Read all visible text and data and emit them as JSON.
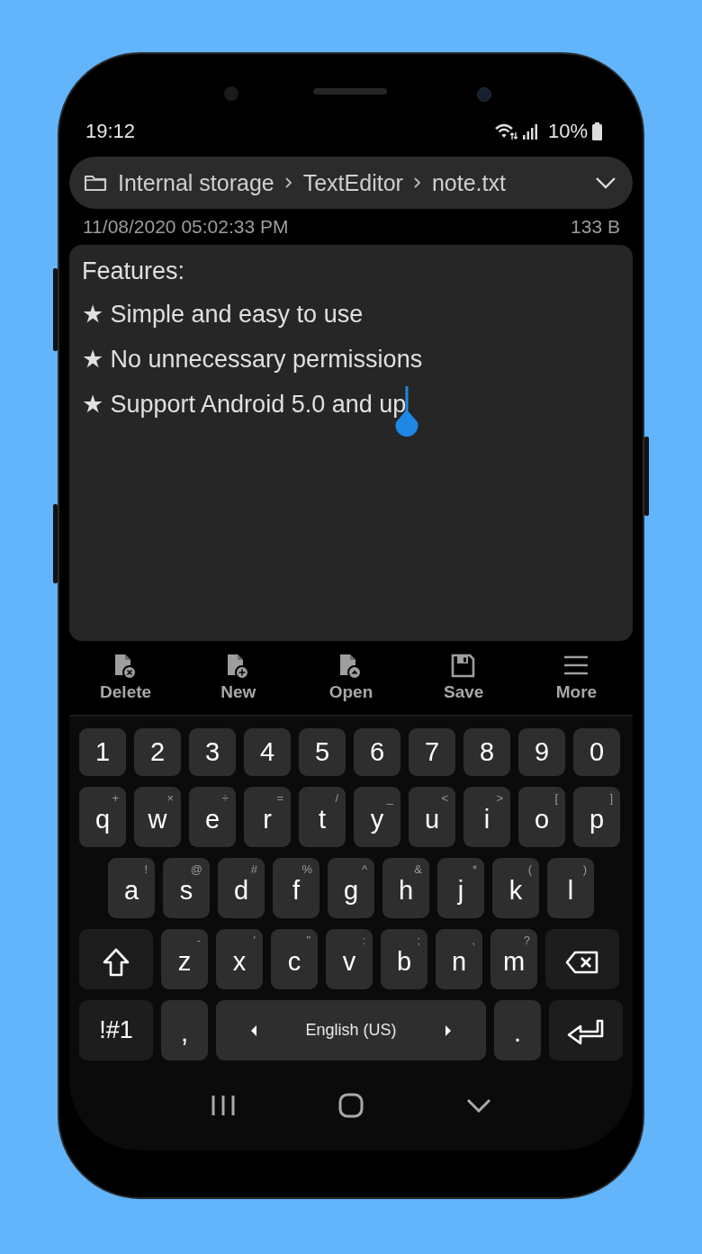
{
  "status_bar": {
    "time": "19:12",
    "battery": "10%"
  },
  "breadcrumb": {
    "parts": [
      "Internal storage",
      "TextEditor",
      "note.txt"
    ]
  },
  "file_info": {
    "modified": "11/08/2020 05:02:33 PM",
    "size": "133 B"
  },
  "editor": {
    "lines": [
      "Features:",
      "★ Simple and easy to use",
      "★ No unnecessary permissions",
      "★ Support Android 5.0 and up"
    ]
  },
  "toolbar": [
    {
      "kind": "delete",
      "label": "Delete"
    },
    {
      "kind": "new",
      "label": "New"
    },
    {
      "kind": "open",
      "label": "Open"
    },
    {
      "kind": "save",
      "label": "Save"
    },
    {
      "kind": "more",
      "label": "More"
    }
  ],
  "keyboard": {
    "rows": [
      {
        "keys": [
          {
            "kind": "char",
            "label": "1"
          },
          {
            "kind": "char",
            "label": "2"
          },
          {
            "kind": "char",
            "label": "3"
          },
          {
            "kind": "char",
            "label": "4"
          },
          {
            "kind": "char",
            "label": "5"
          },
          {
            "kind": "char",
            "label": "6"
          },
          {
            "kind": "char",
            "label": "7"
          },
          {
            "kind": "char",
            "label": "8"
          },
          {
            "kind": "char",
            "label": "9"
          },
          {
            "kind": "char",
            "label": "0"
          }
        ]
      },
      {
        "keys": [
          {
            "kind": "char",
            "label": "q",
            "hint": "+"
          },
          {
            "kind": "char",
            "label": "w",
            "hint": "×"
          },
          {
            "kind": "char",
            "label": "e",
            "hint": "÷"
          },
          {
            "kind": "char",
            "label": "r",
            "hint": "="
          },
          {
            "kind": "char",
            "label": "t",
            "hint": "/"
          },
          {
            "kind": "char",
            "label": "y",
            "hint": "_"
          },
          {
            "kind": "char",
            "label": "u",
            "hint": "<"
          },
          {
            "kind": "char",
            "label": "i",
            "hint": ">"
          },
          {
            "kind": "char",
            "label": "o",
            "hint": "["
          },
          {
            "kind": "char",
            "label": "p",
            "hint": "]"
          }
        ]
      },
      {
        "keys": [
          {
            "kind": "char",
            "label": "a",
            "hint": "!"
          },
          {
            "kind": "char",
            "label": "s",
            "hint": "@"
          },
          {
            "kind": "char",
            "label": "d",
            "hint": "#"
          },
          {
            "kind": "char",
            "label": "f",
            "hint": "%"
          },
          {
            "kind": "char",
            "label": "g",
            "hint": "^"
          },
          {
            "kind": "char",
            "label": "h",
            "hint": "&"
          },
          {
            "kind": "char",
            "label": "j",
            "hint": "*"
          },
          {
            "kind": "char",
            "label": "k",
            "hint": "("
          },
          {
            "kind": "char",
            "label": "l",
            "hint": ")"
          }
        ]
      },
      {
        "keys": [
          {
            "kind": "shift"
          },
          {
            "kind": "char",
            "label": "z",
            "hint": "-"
          },
          {
            "kind": "char",
            "label": "x",
            "hint": "'"
          },
          {
            "kind": "char",
            "label": "c",
            "hint": "\""
          },
          {
            "kind": "char",
            "label": "v",
            "hint": ":"
          },
          {
            "kind": "char",
            "label": "b",
            "hint": ";"
          },
          {
            "kind": "char",
            "label": "n",
            "hint": ","
          },
          {
            "kind": "char",
            "label": "m",
            "hint": "?"
          },
          {
            "kind": "backspace"
          }
        ]
      },
      {
        "keys": [
          {
            "kind": "symbols",
            "label": "!#1"
          },
          {
            "kind": "char",
            "label": ","
          },
          {
            "kind": "space",
            "label": "English (US)"
          },
          {
            "kind": "char",
            "label": "."
          },
          {
            "kind": "enter"
          }
        ]
      }
    ]
  }
}
